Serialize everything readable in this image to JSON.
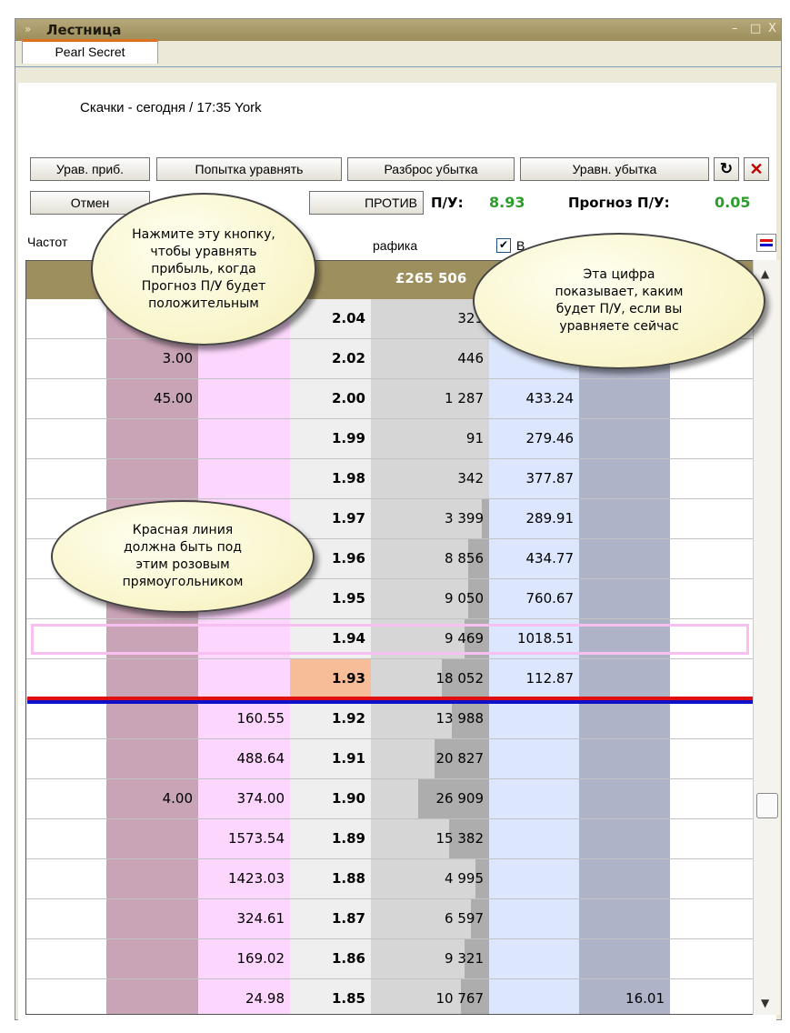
{
  "window": {
    "title": "Лестница",
    "controls": [
      "–",
      "□",
      "X"
    ]
  },
  "tab": {
    "label": "Pearl Secret"
  },
  "race": {
    "label": "Скачки - сегодня / 17:35 York"
  },
  "toolbar": {
    "buttons": [
      "Урав. приб.",
      "Попытка уравнять",
      "Разброс убытка",
      "Уравн. убытка"
    ],
    "row2_left": "Отмен",
    "row2_mid": "ПРОТИВ",
    "pl_label": "П/У:",
    "pl_value": "8.93",
    "forecast_label": "Прогноз П/У:",
    "forecast_value": "0.05",
    "refresh_icon": "refresh-icon",
    "close_icon": "close-icon"
  },
  "options": {
    "freq_label": "Частот",
    "graph_label": "рафика",
    "checkbox": "✔",
    "checkbox_label": "В",
    "lines_icon": "ladder-lines-icon"
  },
  "ladder": {
    "header_money": "£265 506",
    "rows": [
      {
        "c1": "",
        "c2": "",
        "price": "2.04",
        "vol": "321",
        "lay": "",
        "c6": "",
        "volfrac": 0.0
      },
      {
        "c1": "3.00",
        "c2": "",
        "price": "2.02",
        "vol": "446",
        "lay": "2",
        "c6": "",
        "volfrac": 0.0
      },
      {
        "c1": "45.00",
        "c2": "",
        "price": "2.00",
        "vol": "1 287",
        "lay": "433.24",
        "c6": "",
        "volfrac": 0.0
      },
      {
        "c1": "",
        "c2": "",
        "price": "1.99",
        "vol": "91",
        "lay": "279.46",
        "c6": "",
        "volfrac": 0.0
      },
      {
        "c1": "",
        "c2": "",
        "price": "1.98",
        "vol": "342",
        "lay": "377.87",
        "c6": "",
        "volfrac": 0.0
      },
      {
        "c1": "",
        "c2": "",
        "price": "1.97",
        "vol": "3 399",
        "lay": "289.91",
        "c6": "",
        "volfrac": 0.1
      },
      {
        "c1": "",
        "c2": "",
        "price": "1.96",
        "vol": "8 856",
        "lay": "434.77",
        "c6": "",
        "volfrac": 0.3
      },
      {
        "c1": "",
        "c2": "",
        "price": "1.95",
        "vol": "9 050",
        "lay": "760.67",
        "c6": "",
        "volfrac": 0.3
      },
      {
        "c1": "",
        "c2": "",
        "price": "1.94",
        "vol": "9 469",
        "lay": "1018.51",
        "c6": "",
        "volfrac": 0.35
      },
      {
        "c1": "",
        "c2": "",
        "price": "1.93",
        "vol": "18 052",
        "lay": "112.87",
        "c6": "",
        "volfrac": 0.67
      },
      {
        "c1": "",
        "c2": "160.55",
        "price": "1.92",
        "vol": "13 988",
        "lay": "",
        "c6": "",
        "volfrac": 0.52
      },
      {
        "c1": "",
        "c2": "488.64",
        "price": "1.91",
        "vol": "20 827",
        "lay": "",
        "c6": "",
        "volfrac": 0.77
      },
      {
        "c1": "4.00",
        "c2": "374.00",
        "price": "1.90",
        "vol": "26 909",
        "lay": "",
        "c6": "",
        "volfrac": 1.0
      },
      {
        "c1": "",
        "c2": "1573.54",
        "price": "1.89",
        "vol": "15 382",
        "lay": "",
        "c6": "",
        "volfrac": 0.57
      },
      {
        "c1": "",
        "c2": "1423.03",
        "price": "1.88",
        "vol": "4 995",
        "lay": "",
        "c6": "",
        "volfrac": 0.19
      },
      {
        "c1": "",
        "c2": "324.61",
        "price": "1.87",
        "vol": "6 597",
        "lay": "",
        "c6": "",
        "volfrac": 0.25
      },
      {
        "c1": "",
        "c2": "169.02",
        "price": "1.86",
        "vol": "9 321",
        "lay": "",
        "c6": "",
        "volfrac": 0.35
      },
      {
        "c1": "",
        "c2": "24.98",
        "price": "1.85",
        "vol": "10 767",
        "lay": "",
        "c6": "16.01",
        "volfrac": 0.4
      }
    ]
  },
  "callouts": {
    "button_tip": "Нажмите эту кнопку,\nчтобы уравнять\nприбыль, когда\nПрогноз П/У будет\nположительным",
    "forecast_tip": "Эта цифра\nпоказывает, каким\nбудет П/У, если вы\nуравняете сейчас",
    "line_tip": "Красная линия\nдолжна быть под\nэтим розовым\nпрямоугольником"
  },
  "colors": {
    "red_line": "#e01010",
    "blue_line": "#1010c8",
    "pink_outline": "#f8c0f0",
    "green_value": "#2c9e2c"
  }
}
